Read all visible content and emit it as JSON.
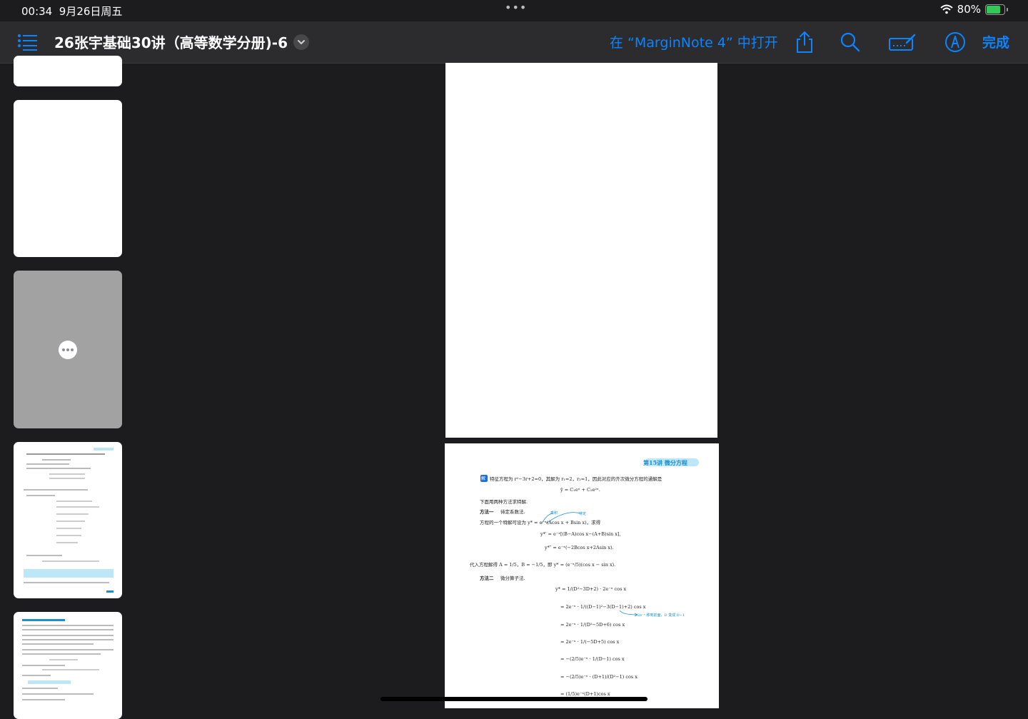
{
  "status": {
    "time": "00:34",
    "date": "9月26日周五",
    "battery": "80%",
    "battery_level": 0.8
  },
  "toolbar": {
    "title": "26张宇基础30讲（高等数学分册)-6",
    "open_in": "在 “MarginNote 4” 中打开",
    "done": "完成",
    "icons": [
      "list-icon",
      "chevron-down-icon",
      "share-icon",
      "search-icon",
      "markup-icon",
      "pencil-circle-icon"
    ]
  },
  "thumbnails": [
    {
      "state": "blank"
    },
    {
      "state": "blank"
    },
    {
      "state": "loading",
      "icon": "more-icon"
    },
    {
      "state": "content"
    },
    {
      "state": "content"
    }
  ],
  "page": {
    "header": "第15讲  微分方程",
    "solve_label": "解",
    "line1": "特征方程为 r²−3r+2=0，其解为 r₁=2，r₂=1，因此对应的齐次微分方程的通解是",
    "eq1": "ȳ = C₁eˣ + C₂e²ˣ.",
    "intro": "下面用两种方法求特解.",
    "method1_label": "方法一",
    "method1_text": "待定系数法.",
    "line2": "方程的一个特解可设为 y* = e⁻ˣ(Acos x + Bsin x)，求得",
    "note1": "乘积",
    "note2": "待定",
    "eq2": "y*′ = e⁻ˣ[(B−A)cos x−(A+B)sin x],",
    "eq3": "y*″ = e⁻ˣ(−2Bcos x+2Asin x).",
    "line3": "代入方程解得 A = 1/5，B = −1/5，即 y* = (e⁻ˣ/5)(cos x − sin x).",
    "method2_label": "方法二",
    "method2_text": "微分算子法.",
    "steps": [
      "y* = 1/(D²−3D+2) · 2e⁻ˣ cos x",
      "= 2e⁻ˣ · 1/((D−1)²−3(D−1)+2) cos x",
      "= 2e⁻ˣ · 1/(D²−5D+6) cos x",
      "= 2e⁻ˣ · 1/(−5D+5) cos x",
      "= −(2/5)e⁻ˣ · 1/(D−1) cos x",
      "= −(2/5)e⁻ˣ · (D+1)/(D²−1) cos x",
      "= (1/5)e⁻ˣ(D+1)cos x"
    ],
    "side_note": "2e⁻ˣ 移到前面，D 变成 D−1"
  }
}
